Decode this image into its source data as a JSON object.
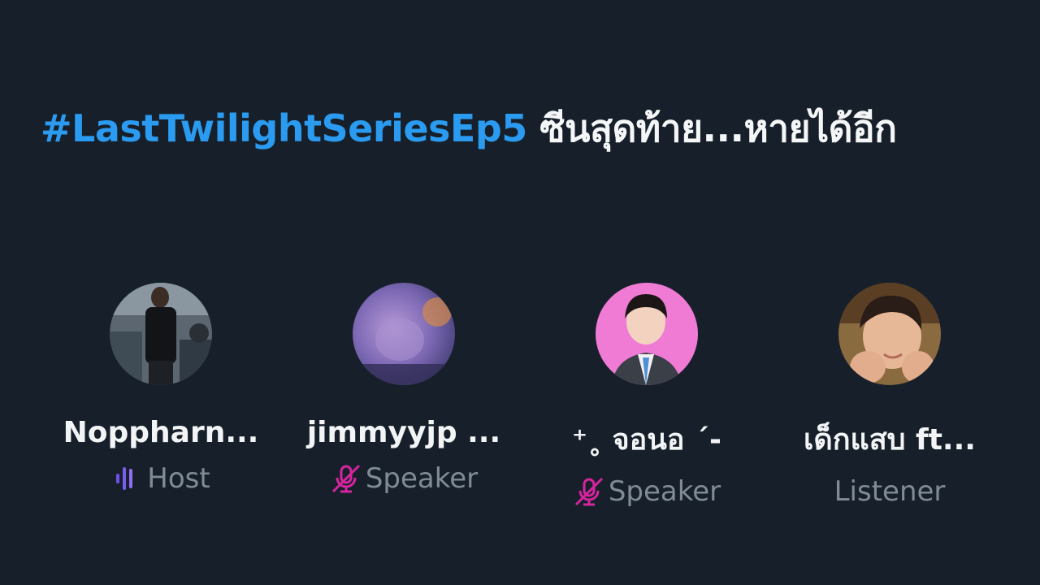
{
  "space": {
    "hashtag": "#LastTwilightSeriesEp5",
    "title_rest": " ซีนสุดท้าย...หายได้อีก"
  },
  "participants": [
    {
      "name": "Noppharn...",
      "role": "Host",
      "role_icon": "speaking-bars-icon",
      "icon_color": "#7b5cf0"
    },
    {
      "name": "jimmyyjp ...",
      "role": "Speaker",
      "role_icon": "mic-muted-icon",
      "icon_color": "#d6249f"
    },
    {
      "name": "⁺˳ จอนอ ´-",
      "role": "Speaker",
      "role_icon": "mic-muted-icon",
      "icon_color": "#d6249f"
    },
    {
      "name": "เด็กแสบ ft...",
      "role": "Listener",
      "role_icon": "",
      "icon_color": ""
    }
  ],
  "colors": {
    "background": "#17202a",
    "accent": "#2a9bf0",
    "muted_text": "#7f8b96"
  }
}
